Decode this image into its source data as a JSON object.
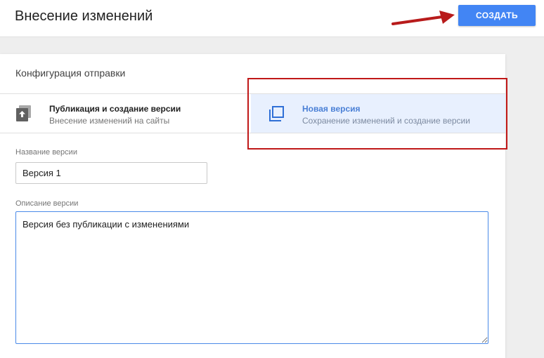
{
  "header": {
    "title": "Внесение изменений",
    "create_label": "СОЗДАТЬ"
  },
  "card": {
    "title": "Конфигурация отправки",
    "options": [
      {
        "icon": "publish-icon",
        "title": "Публикация и создание версии",
        "subtitle": "Внесение изменений на сайты",
        "selected": false
      },
      {
        "icon": "copy-version-icon",
        "title": "Новая версия",
        "subtitle": "Сохранение изменений и создание версии",
        "selected": true
      }
    ],
    "version_name": {
      "label": "Название версии",
      "value": "Версия 1"
    },
    "version_description": {
      "label": "Описание версии",
      "value": "Версия без публикации с изменениями"
    }
  },
  "colors": {
    "accent": "#4285f4",
    "selected_bg": "#e8f0fe",
    "annotation_red": "#c01818"
  }
}
